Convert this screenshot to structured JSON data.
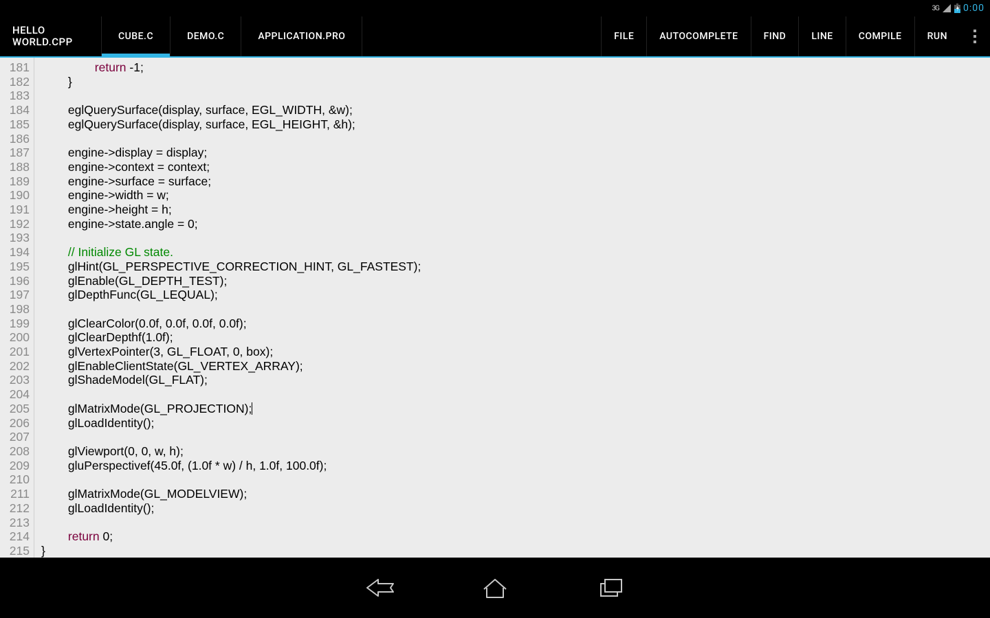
{
  "status": {
    "network": "3G",
    "clock": "0:00"
  },
  "app": {
    "title_l1": "HELLO",
    "title_l2": "WORLD.CPP"
  },
  "tabs": [
    {
      "label": "CUBE.C",
      "active": true
    },
    {
      "label": "DEMO.C",
      "active": false
    },
    {
      "label": "APPLICATION.PRO",
      "active": false
    }
  ],
  "actions": [
    {
      "label": "FILE"
    },
    {
      "label": "AUTOCOMPLETE"
    },
    {
      "label": "FIND"
    },
    {
      "label": "LINE"
    },
    {
      "label": "COMPILE"
    },
    {
      "label": "RUN"
    }
  ],
  "editor": {
    "first_line": 181,
    "lines": [
      {
        "indent": 2,
        "tokens": [
          {
            "t": "kw",
            "v": "return"
          },
          {
            "v": " -1;"
          }
        ]
      },
      {
        "indent": 1,
        "tokens": [
          {
            "v": "}"
          }
        ]
      },
      {
        "indent": 0,
        "tokens": []
      },
      {
        "indent": 1,
        "tokens": [
          {
            "v": "eglQuerySurface(display, surface, EGL_WIDTH, &w);"
          }
        ]
      },
      {
        "indent": 1,
        "tokens": [
          {
            "v": "eglQuerySurface(display, surface, EGL_HEIGHT, &h);"
          }
        ]
      },
      {
        "indent": 0,
        "tokens": []
      },
      {
        "indent": 1,
        "tokens": [
          {
            "v": "engine->display = display;"
          }
        ]
      },
      {
        "indent": 1,
        "tokens": [
          {
            "v": "engine->context = context;"
          }
        ]
      },
      {
        "indent": 1,
        "tokens": [
          {
            "v": "engine->surface = surface;"
          }
        ]
      },
      {
        "indent": 1,
        "tokens": [
          {
            "v": "engine->width = w;"
          }
        ]
      },
      {
        "indent": 1,
        "tokens": [
          {
            "v": "engine->height = h;"
          }
        ]
      },
      {
        "indent": 1,
        "tokens": [
          {
            "v": "engine->state.angle = 0;"
          }
        ]
      },
      {
        "indent": 0,
        "tokens": []
      },
      {
        "indent": 1,
        "tokens": [
          {
            "t": "cm",
            "v": "// Initialize GL state."
          }
        ]
      },
      {
        "indent": 1,
        "tokens": [
          {
            "v": "glHint(GL_PERSPECTIVE_CORRECTION_HINT, GL_FASTEST);"
          }
        ]
      },
      {
        "indent": 1,
        "tokens": [
          {
            "v": "glEnable(GL_DEPTH_TEST);"
          }
        ]
      },
      {
        "indent": 1,
        "tokens": [
          {
            "v": "glDepthFunc(GL_LEQUAL);"
          }
        ]
      },
      {
        "indent": 0,
        "tokens": []
      },
      {
        "indent": 1,
        "tokens": [
          {
            "v": "glClearColor(0.0f, 0.0f, 0.0f, 0.0f);"
          }
        ]
      },
      {
        "indent": 1,
        "tokens": [
          {
            "v": "glClearDepthf(1.0f);"
          }
        ]
      },
      {
        "indent": 1,
        "tokens": [
          {
            "v": "glVertexPointer(3, GL_FLOAT, 0, box);"
          }
        ]
      },
      {
        "indent": 1,
        "tokens": [
          {
            "v": "glEnableClientState(GL_VERTEX_ARRAY);"
          }
        ]
      },
      {
        "indent": 1,
        "tokens": [
          {
            "v": "glShadeModel(GL_FLAT);"
          }
        ]
      },
      {
        "indent": 0,
        "tokens": []
      },
      {
        "indent": 1,
        "tokens": [
          {
            "v": "glMatrixMode(GL_PROJECTION);"
          }
        ],
        "caret": true
      },
      {
        "indent": 1,
        "tokens": [
          {
            "v": "glLoadIdentity();"
          }
        ]
      },
      {
        "indent": 0,
        "tokens": []
      },
      {
        "indent": 1,
        "tokens": [
          {
            "v": "glViewport(0, 0, w, h);"
          }
        ]
      },
      {
        "indent": 1,
        "tokens": [
          {
            "v": "gluPerspectivef(45.0f, (1.0f * w) / h, 1.0f, 100.0f);"
          }
        ]
      },
      {
        "indent": 0,
        "tokens": []
      },
      {
        "indent": 1,
        "tokens": [
          {
            "v": "glMatrixMode(GL_MODELVIEW);"
          }
        ]
      },
      {
        "indent": 1,
        "tokens": [
          {
            "v": "glLoadIdentity();"
          }
        ]
      },
      {
        "indent": 0,
        "tokens": []
      },
      {
        "indent": 1,
        "tokens": [
          {
            "t": "kw",
            "v": "return"
          },
          {
            "v": " 0;"
          }
        ]
      },
      {
        "indent": 0,
        "tokens": [
          {
            "v": "}"
          }
        ]
      }
    ],
    "indent_unit": "        "
  }
}
